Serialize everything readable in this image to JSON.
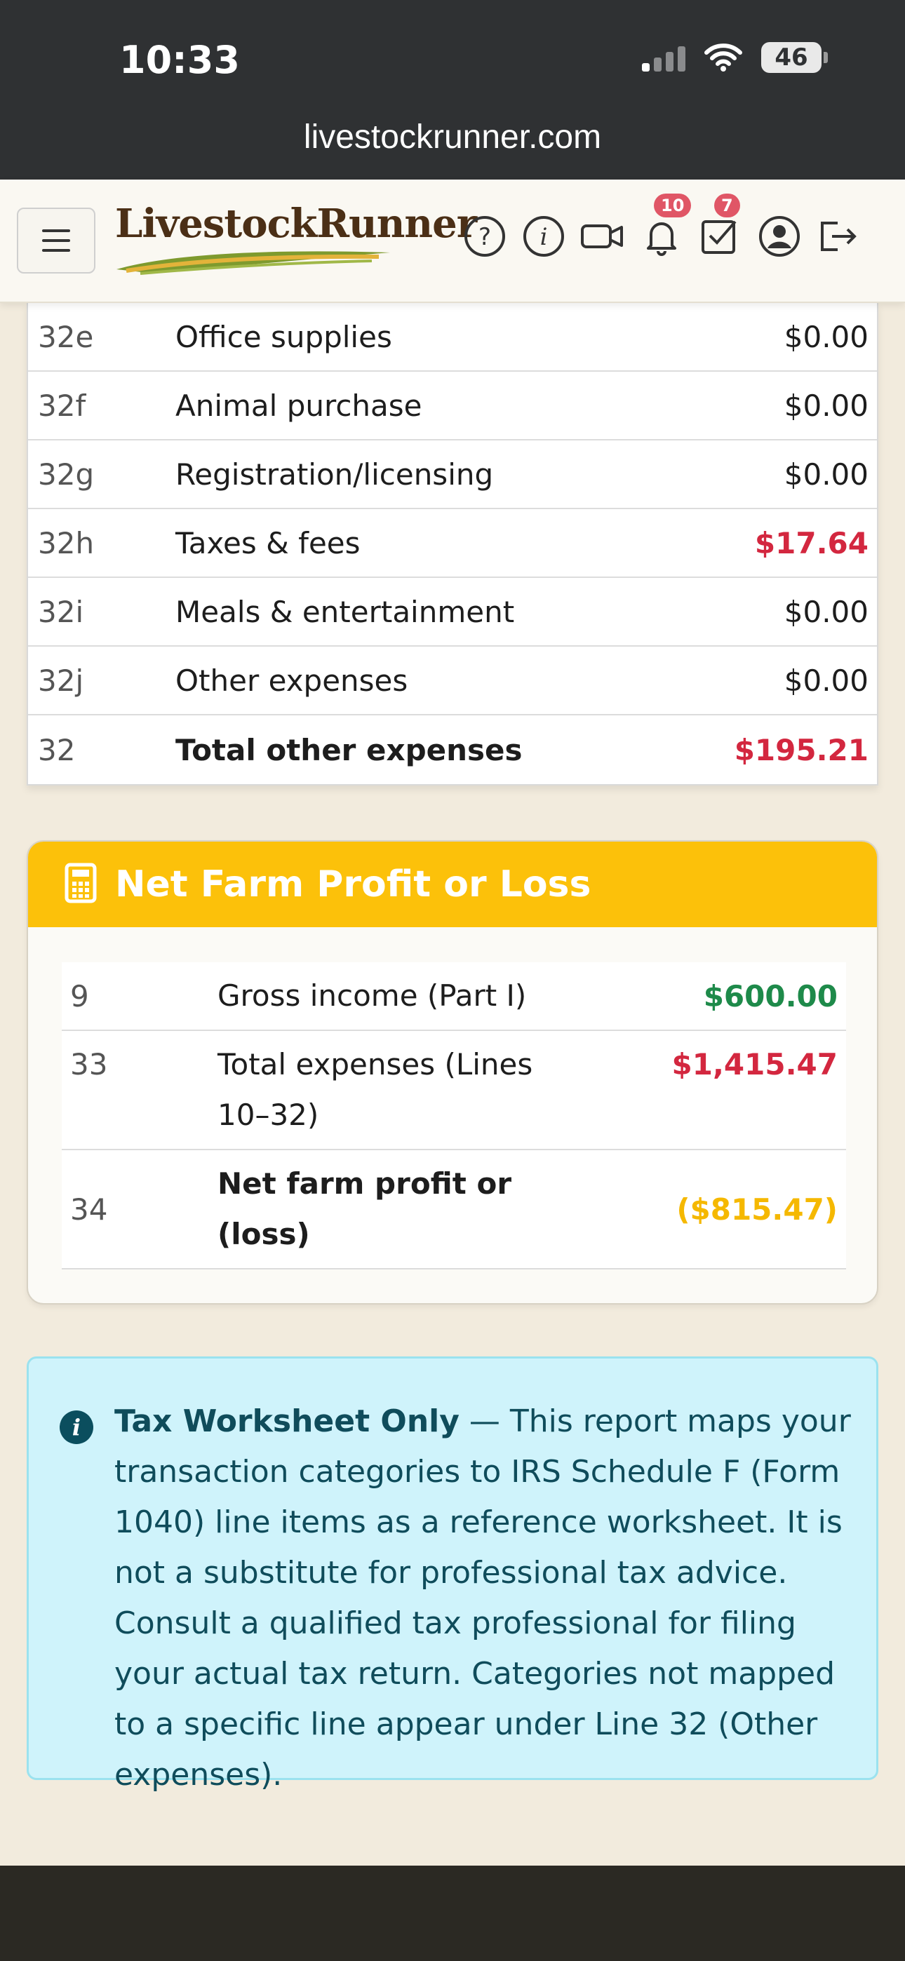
{
  "status_bar": {
    "time": "10:33",
    "battery": "46",
    "url": "livestockrunner.com"
  },
  "header": {
    "logo_text": "LivestockRunner",
    "icons": [
      "help-icon",
      "info-icon",
      "video-icon",
      "bell-icon",
      "checkbox-icon",
      "user-icon",
      "logout-icon"
    ],
    "notifications_count": "10",
    "tasks_count": "7"
  },
  "other_expenses": {
    "rows": [
      {
        "line": "32e",
        "desc": "Office supplies",
        "amount": "$0.00"
      },
      {
        "line": "32f",
        "desc": "Animal purchase",
        "amount": "$0.00"
      },
      {
        "line": "32g",
        "desc": "Registration/licensing",
        "amount": "$0.00"
      },
      {
        "line": "32h",
        "desc": "Taxes & fees",
        "amount": "$17.64"
      },
      {
        "line": "32i",
        "desc": "Meals & entertainment",
        "amount": "$0.00"
      },
      {
        "line": "32j",
        "desc": "Other expenses",
        "amount": "$0.00"
      },
      {
        "line": "32",
        "desc": "Total other expenses",
        "amount": "$195.21"
      }
    ]
  },
  "net_farm": {
    "title": "Net Farm Profit or Loss",
    "rows": [
      {
        "line": "9",
        "desc": "Gross income (Part I)",
        "amount": "$600.00"
      },
      {
        "line": "33",
        "desc": "Total expenses (Lines 10–32)",
        "amount": "$1,415.47"
      },
      {
        "line": "34",
        "desc": "Net farm profit or (loss)",
        "amount": "($815.47)"
      }
    ]
  },
  "alert": {
    "title": "Tax Worksheet Only",
    "body": " — This report maps your transaction categories to IRS Schedule F (Form 1040) line items as a reference worksheet. It is not a substitute for professional tax advice. Consult a qualified tax professional for filing your actual tax return. Categories not mapped to a specific line appear under Line 32 (Other expenses)."
  },
  "colors": {
    "accent_yellow": "#fcc10a",
    "expense_red": "#d3273f",
    "income_green": "#1e8a4a",
    "loss_amber": "#f5b800",
    "info_bg": "#cff3fb"
  }
}
